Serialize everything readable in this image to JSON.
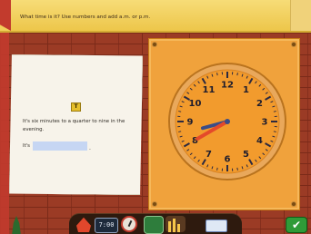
{
  "instruction": "What time is it? Use numbers and add a.m. or p.m.",
  "card": {
    "icon": "T",
    "question": "It's six minutes to a quarter to nine in the evening.",
    "answer_label": "It's",
    "answer_value": "",
    "trailing": "."
  },
  "clock": {
    "numbers": [
      "12",
      "1",
      "2",
      "3",
      "4",
      "5",
      "6",
      "7",
      "8",
      "9",
      "10",
      "11"
    ],
    "hour_hand_angle_deg": 255,
    "minute_hand_angle_deg": 240,
    "face_color": "#f29b2d",
    "rim_color": "#e6a24a"
  },
  "toolbar": {
    "clock_display": "7:00",
    "check_icon": "✔"
  },
  "icons": {
    "home": "home-icon",
    "digital": "digital-clock-icon",
    "gauge": "gauge-icon",
    "green": "green-panel-icon",
    "bars": "bar-chart-icon",
    "eraser": "eraser-icon",
    "check": "check-icon"
  }
}
